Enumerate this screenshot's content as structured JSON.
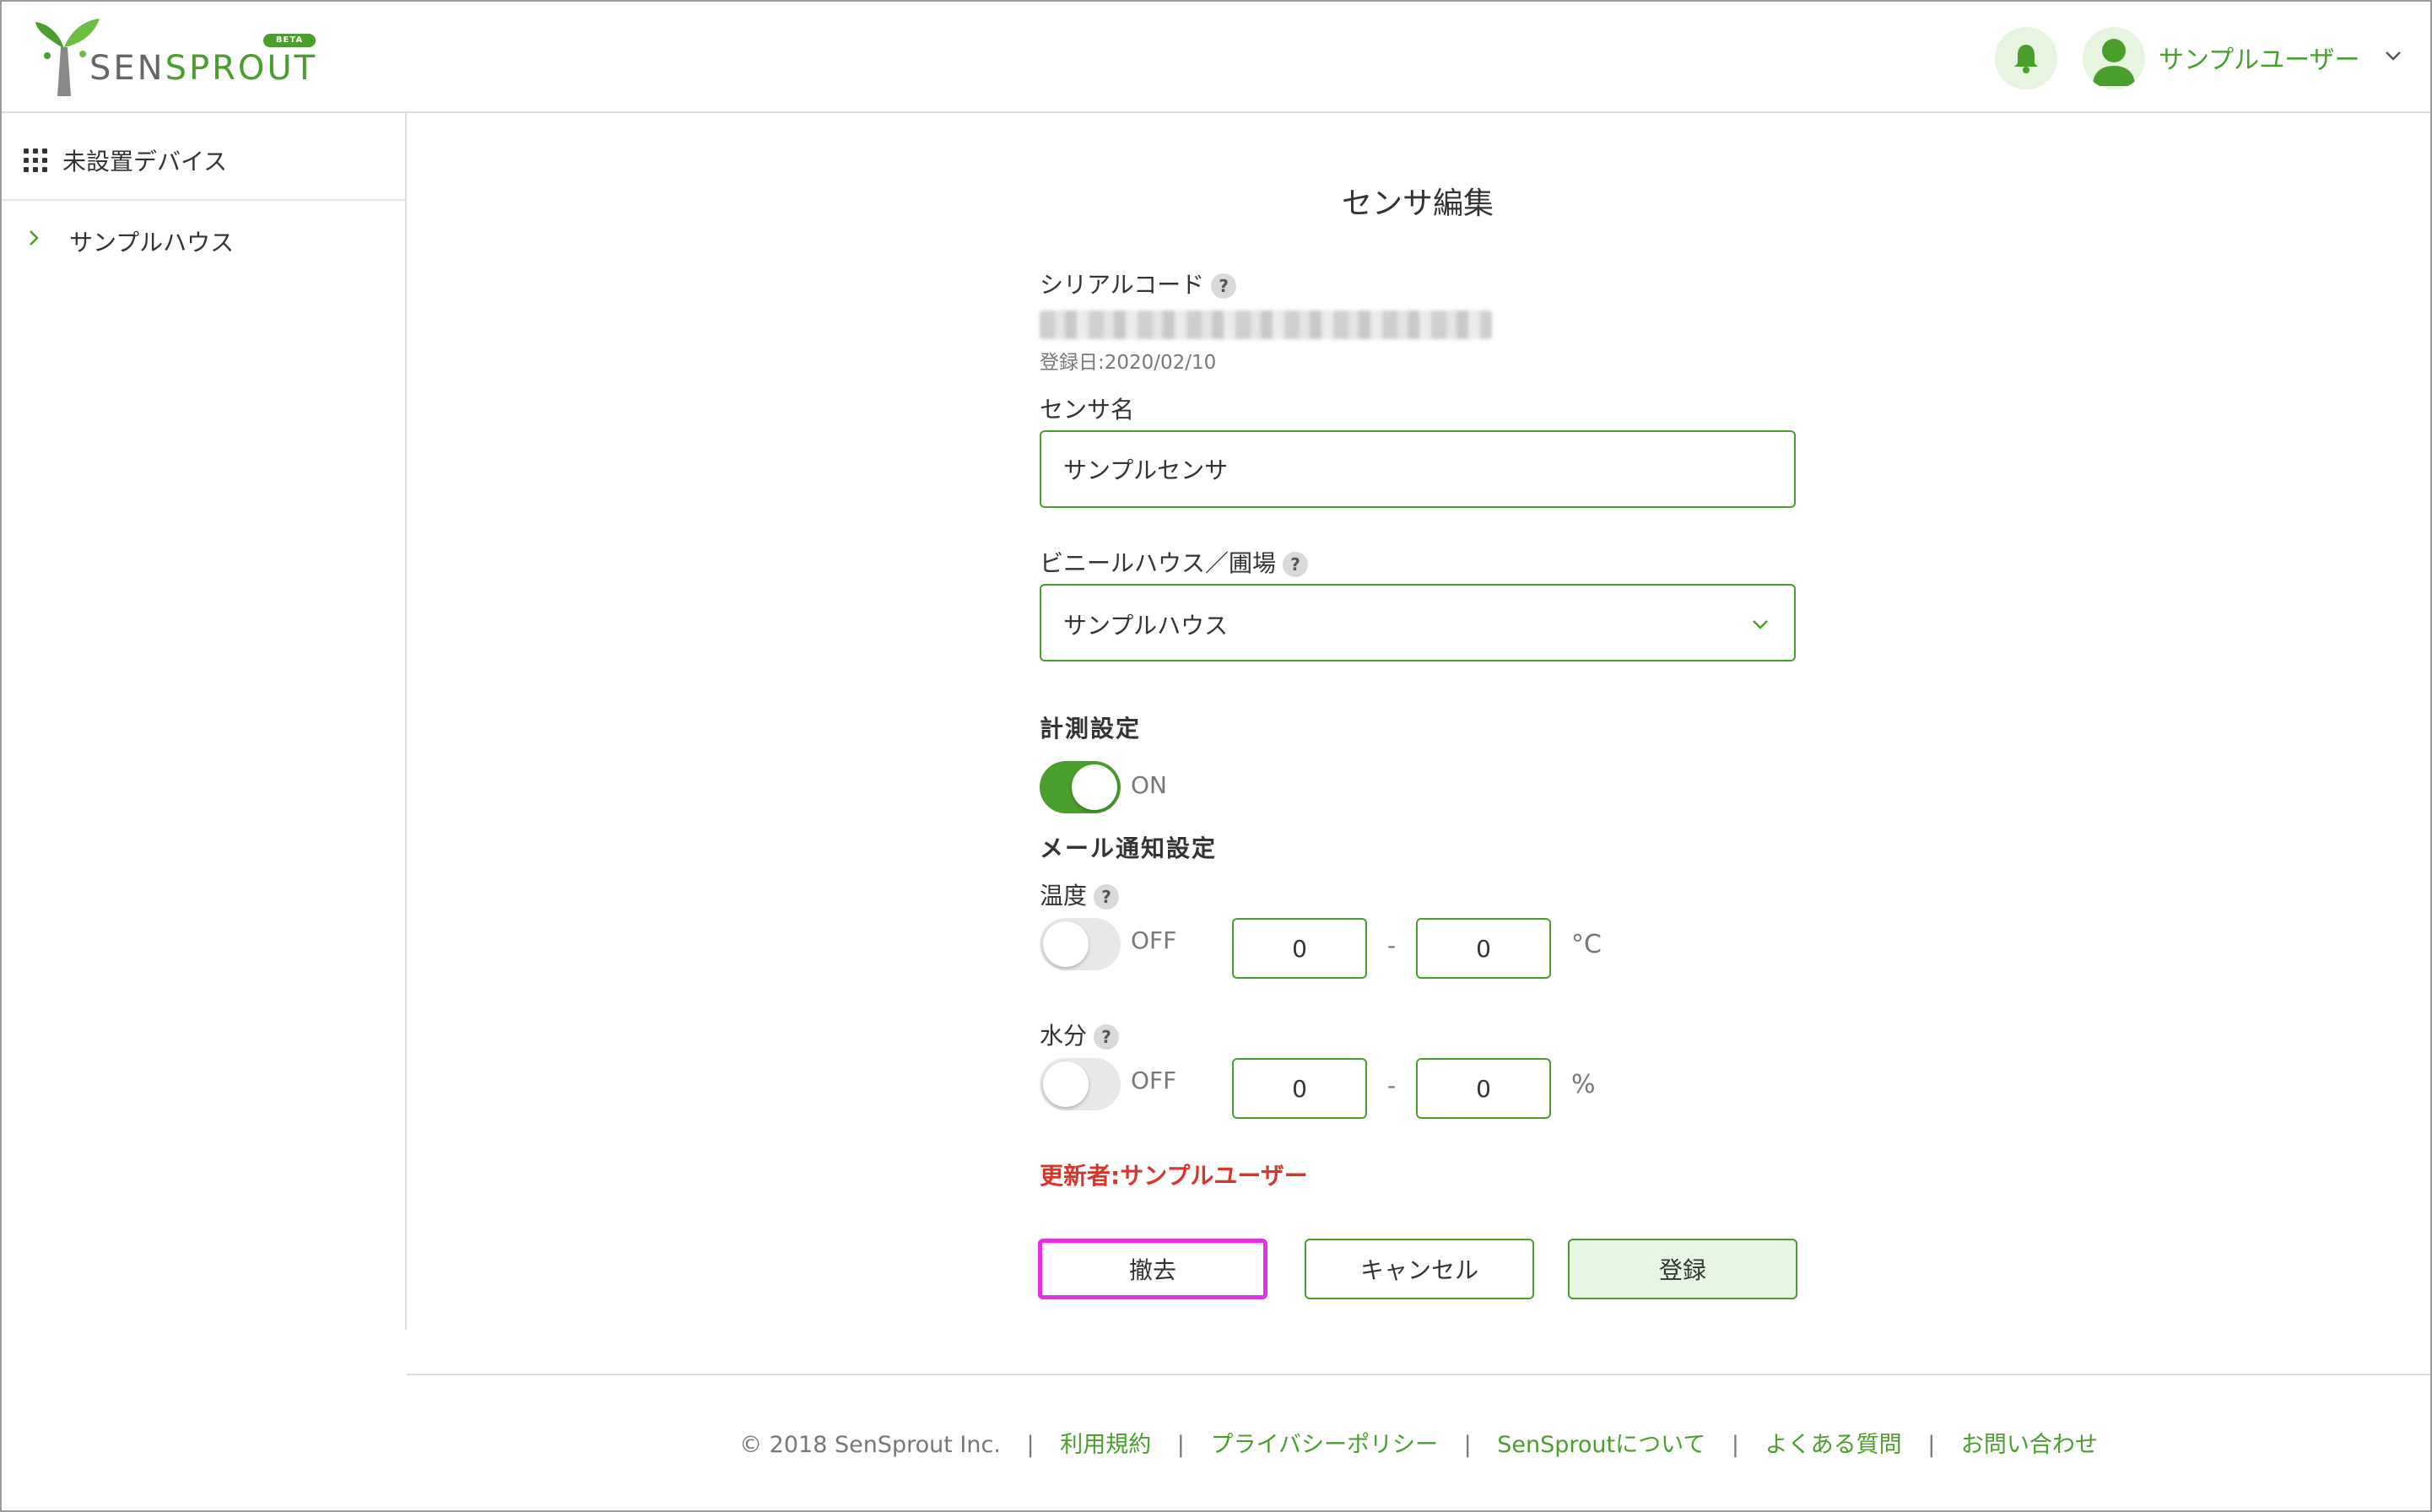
{
  "header": {
    "logo_text_a": "SEN",
    "logo_text_b": "SPROUT",
    "beta_badge": "BETA",
    "user_name": "サンプルユーザー"
  },
  "sidebar": {
    "items": [
      {
        "label": "未設置デバイス"
      },
      {
        "label": "サンプルハウス"
      }
    ]
  },
  "form": {
    "title": "センサ編集",
    "serial_label": "シリアルコード",
    "help_mark": "?",
    "registered_date": "登録日:2020/02/10",
    "sensor_name_label": "センサ名",
    "sensor_name_value": "サンプルセンサ",
    "house_label": "ビニールハウス／圃場",
    "house_value": "サンプルハウス",
    "measure_label": "計測設定",
    "measure_toggle_text": "ON",
    "mail_label": "メール通知設定",
    "temperature": {
      "label": "温度",
      "toggle_text": "OFF",
      "min": "0",
      "sep": "-",
      "max": "0",
      "unit": "°C"
    },
    "moisture": {
      "label": "水分",
      "toggle_text": "OFF",
      "min": "0",
      "sep": "-",
      "max": "0",
      "unit": "%"
    },
    "updater": "更新者:サンプルユーザー",
    "buttons": {
      "remove": "撤去",
      "cancel": "キャンセル",
      "submit": "登録"
    }
  },
  "footer": {
    "copyright": "© 2018 SenSprout Inc.",
    "sep": "|",
    "links": [
      "利用規約",
      "プライバシーポリシー",
      "SenSproutについて",
      "よくある質問",
      "お問い合わせ"
    ]
  },
  "colors": {
    "accent": "#4a9e2c",
    "accent_light": "#e7f6e2",
    "alert": "#d9362b",
    "highlight": "#e62ee6"
  },
  "icons": {
    "logo": "sprout-logo-icon",
    "bell": "bell-icon",
    "avatar": "user-avatar-icon",
    "grid": "grid-icon",
    "chevron_right": "chevron-right-icon",
    "chevron_down": "chevron-down-icon"
  }
}
